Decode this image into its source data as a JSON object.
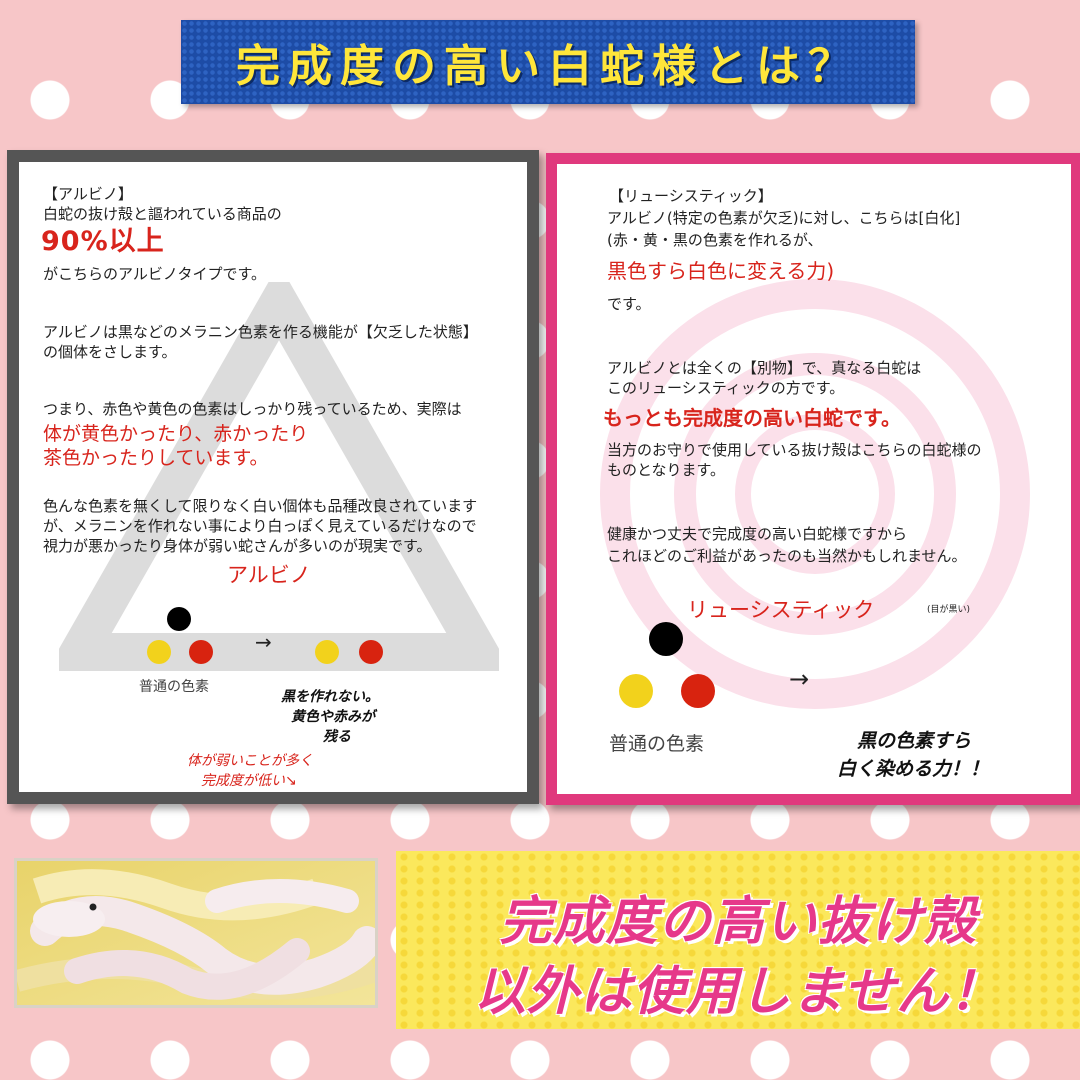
{
  "title": "完成度の高い白蛇様とは？",
  "left": {
    "heading": "【アルビノ】",
    "line1": "白蛇の抜け殻と謳われている商品の",
    "highlight_percent": "90%以上",
    "line2": "がこちらのアルビノタイプです。",
    "para2_l1": "アルビノは黒などのメラニン色素を作る機能が【欠乏した状態】",
    "para2_l2": "の個体をさします。",
    "para3_l1": "つまり、赤色や黄色の色素はしっかり残っているため、実際は",
    "para3_red1": "体が黄色かったり、赤かったり",
    "para3_red2": "茶色かったりしています。",
    "para4_l1": "色んな色素を無くして限りなく白い個体も品種改良されています",
    "para4_l2": "が、メラニンを作れない事により白っぽく見えているだけなので",
    "para4_l3": "視力が悪かったり身体が弱い蛇さんが多いのが現実です。",
    "diagram_label": "アルビノ",
    "arrow": "→",
    "normal_label": "普通の色素",
    "note_l1": "黒を作れない。",
    "note_l2": "黄色や赤みが",
    "note_l3": "残る",
    "hand_l1": "体が弱いことが多く",
    "hand_l2": "完成度が低い↘"
  },
  "right": {
    "heading": "【リューシスティック】",
    "line1": "アルビノ(特定の色素が欠乏)に対し、こちらは[白化]",
    "line2": "(赤・黄・黒の色素を作れるが、",
    "highlight1": "黒色すら白色に変える力)",
    "line3": "です。",
    "para2_l1": "アルビノとは全くの【別物】で、真なる白蛇は",
    "para2_l2": "このリューシスティックの方です。",
    "highlight2": "もっとも完成度の高い白蛇です。",
    "para3_l1": "当方のお守りで使用している抜け殻はこちらの白蛇様の",
    "para3_l2": "ものとなります。",
    "para4_l1": "健康かつ丈夫で完成度の高い白蛇様ですから",
    "para4_l2": "これほどのご利益があったのも当然かもしれません。",
    "diagram_label": "リューシスティック",
    "diagram_note": "(目が黒い)",
    "arrow": "→",
    "normal_label": "普通の色素",
    "power_l1": "黒の色素すら",
    "power_l2": "白く染める力！！"
  },
  "bottom": {
    "line1": "完成度の高い抜け殻",
    "line2": "以外は使用しません！"
  },
  "colors": {
    "background": "#f7c6c8",
    "banner_blue": "#1d4ca6",
    "title_yellow": "#ffe63a",
    "accent_red": "#d8241c",
    "accent_pink": "#e0397d",
    "pigment_black": "#000000",
    "pigment_yellow": "#f2d21c",
    "pigment_red": "#d8230f"
  }
}
